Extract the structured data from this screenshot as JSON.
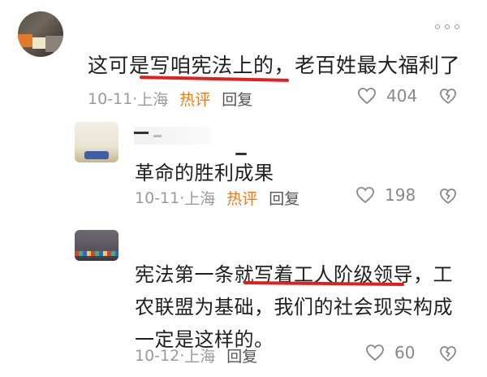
{
  "colors": {
    "accent_hot": "#f07a1a",
    "underline": "#e0211b",
    "meta": "#9a9a9a"
  },
  "icons": {
    "like": "heart-outline",
    "dislike": "broken-heart-outline",
    "more": "three-dots"
  },
  "comment": {
    "text": "这可是写咱宪法上的，老百姓最大福利了",
    "date": "10-11",
    "location": "上海",
    "hot_label": "热评",
    "reply_label": "回复",
    "likes": "404"
  },
  "replies": [
    {
      "text": "革命的胜利成果",
      "date": "10-11",
      "location": "上海",
      "hot_label": "热评",
      "reply_label": "回复",
      "likes": "198"
    },
    {
      "text": "宪法第一条就写着工人阶级领导，工农联盟为基础，我们的社会现实构成一定是这样的。",
      "date": "10-12",
      "location": "上海",
      "reply_label": "回复",
      "likes": "60"
    }
  ]
}
